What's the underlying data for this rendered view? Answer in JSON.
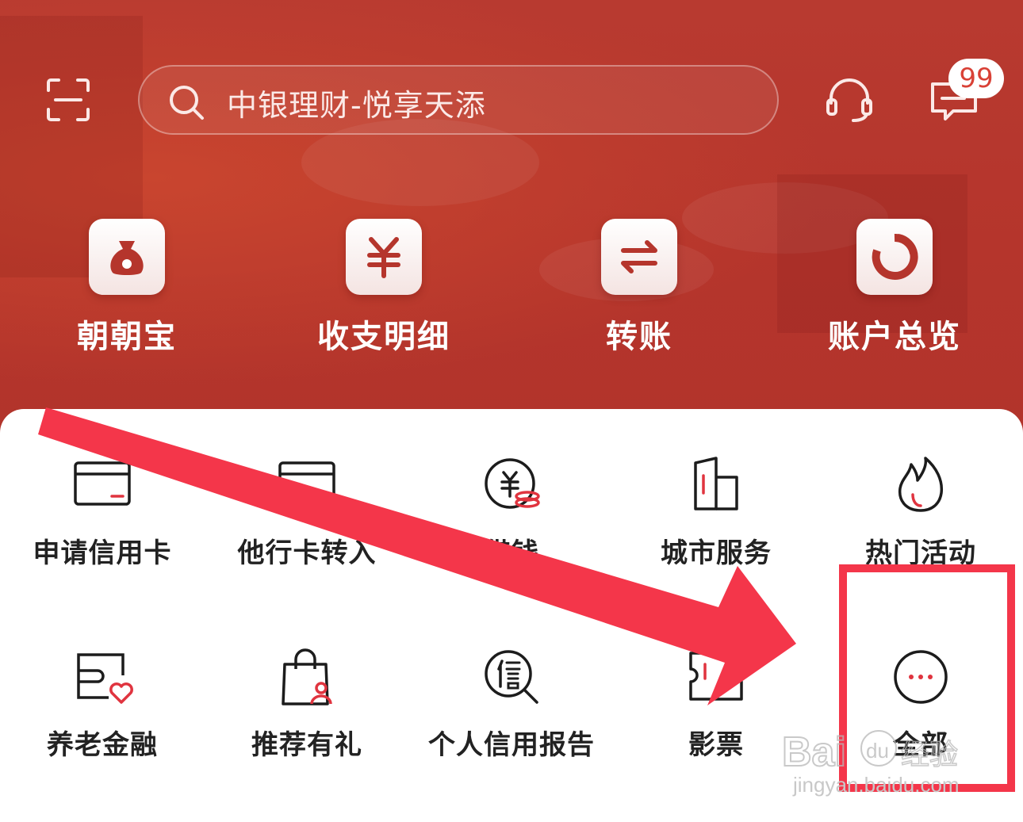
{
  "search": {
    "placeholder": "中银理财-悦享天添"
  },
  "message_badge": "99",
  "quick_actions": [
    {
      "label": "朝朝宝",
      "icon": "money-bag-icon"
    },
    {
      "label": "收支明细",
      "icon": "yuan-icon"
    },
    {
      "label": "转账",
      "icon": "transfer-arrows-icon"
    },
    {
      "label": "账户总览",
      "icon": "pie-ring-icon"
    }
  ],
  "services": [
    {
      "label": "申请信用卡",
      "icon": "credit-card-icon"
    },
    {
      "label": "他行卡转入",
      "icon": "card-transfer-icon"
    },
    {
      "label": "借钱",
      "icon": "loan-coin-icon"
    },
    {
      "label": "城市服务",
      "icon": "city-buildings-icon"
    },
    {
      "label": "热门活动",
      "icon": "flame-icon"
    },
    {
      "label": "养老金融",
      "icon": "wallet-heart-icon"
    },
    {
      "label": "推荐有礼",
      "icon": "shopping-bag-user-icon"
    },
    {
      "label": "个人信用报告",
      "icon": "credit-report-search-icon"
    },
    {
      "label": "影票",
      "icon": "ticket-icon"
    },
    {
      "label": "全部",
      "icon": "more-dots-icon"
    }
  ],
  "watermark": {
    "text": "jingyan.baidu.com",
    "logo_text": "Baidu 经验"
  },
  "colors": {
    "header_red": "#b5352c",
    "accent_red": "#e0343f",
    "highlight": "#f4364a"
  }
}
